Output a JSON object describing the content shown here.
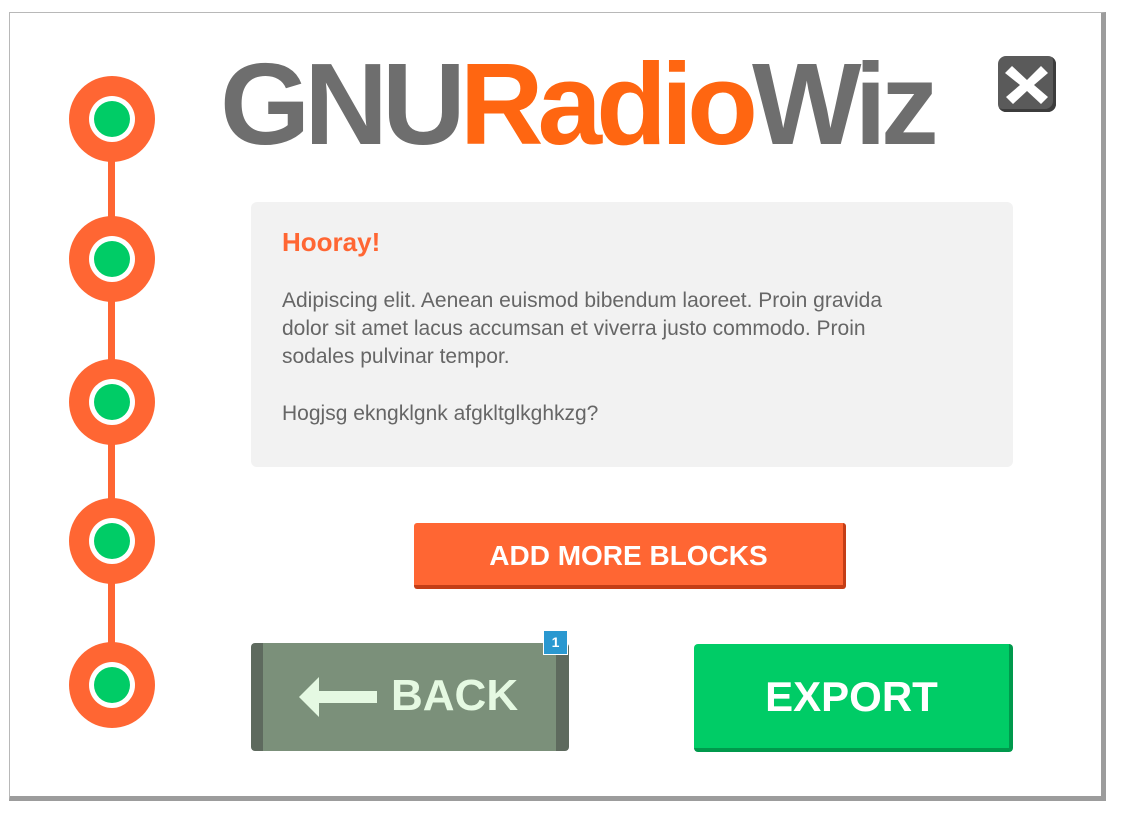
{
  "window": {
    "logo": {
      "part1": "GNU",
      "part2": "Radio",
      "part3": "Wiz"
    }
  },
  "stepper": {
    "steps": 5,
    "icon": "progress-step-icon"
  },
  "message": {
    "title": "Hooray!",
    "body": "Adipiscing elit. Aenean euismod bibendum laoreet. Proin gravida dolor sit amet lacus accumsan et viverra justo commodo. Proin sodales pulvinar tempor.",
    "question": "Hogjsg ekngklgnk afgkltglkghkzg?"
  },
  "actions": {
    "add_more_blocks_label": "ADD MORE BLOCKS",
    "back_label": "BACK",
    "back_badge": "1",
    "export_label": "EXPORT"
  },
  "icons": {
    "close": "close-icon",
    "back": "arrow-left-icon"
  },
  "colors": {
    "accent_orange": "#ff6633",
    "logo_orange": "#ff6611",
    "logo_gray": "#6e6e6e",
    "export_green": "#00cc66",
    "back_gray_green": "#7b907a",
    "badge_blue": "#2a98d0"
  }
}
